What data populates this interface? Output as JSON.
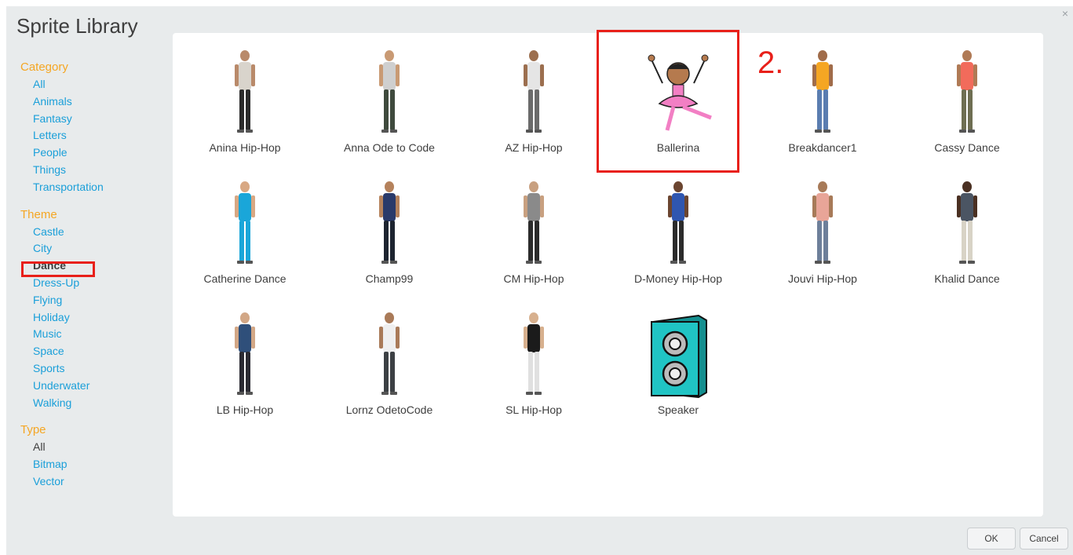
{
  "dialog": {
    "title": "Sprite Library",
    "close_glyph": "×"
  },
  "sidebar": {
    "category": {
      "heading": "Category",
      "items": [
        "All",
        "Animals",
        "Fantasy",
        "Letters",
        "People",
        "Things",
        "Transportation"
      ]
    },
    "theme": {
      "heading": "Theme",
      "items": [
        "Castle",
        "City",
        "Dance",
        "Dress-Up",
        "Flying",
        "Holiday",
        "Music",
        "Space",
        "Sports",
        "Underwater",
        "Walking"
      ],
      "selected": "Dance"
    },
    "type": {
      "heading": "Type",
      "items": [
        "All",
        "Bitmap",
        "Vector"
      ],
      "selected": "All"
    }
  },
  "sprites": [
    {
      "name": "Anina Hip-Hop",
      "kind": "person",
      "shirt": "#d9d4cc",
      "pants": "#2b2b2b",
      "skin": "#b98a6a"
    },
    {
      "name": "Anna Ode to Code",
      "kind": "person",
      "shirt": "#cfcfcf",
      "pants": "#3f4a3d",
      "skin": "#c99a74"
    },
    {
      "name": "AZ Hip-Hop",
      "kind": "person",
      "shirt": "#e5e5e5",
      "pants": "#6b6b6b",
      "skin": "#9c6f4f"
    },
    {
      "name": "Ballerina",
      "kind": "ballerina",
      "shirt": "#f27fc4",
      "pants": "#f27fc4",
      "skin": "#b57a4e"
    },
    {
      "name": "Breakdancer1",
      "kind": "person",
      "shirt": "#f5a623",
      "pants": "#5a7db0",
      "skin": "#a06c4a"
    },
    {
      "name": "Cassy Dance",
      "kind": "person",
      "shirt": "#f26b5b",
      "pants": "#6e6e52",
      "skin": "#b07a55"
    },
    {
      "name": "Catherine Dance",
      "kind": "person",
      "shirt": "#1aa6d9",
      "pants": "#1aa6d9",
      "skin": "#d8a883"
    },
    {
      "name": "Champ99",
      "kind": "person",
      "shirt": "#2a3a6a",
      "pants": "#1d2430",
      "skin": "#b5825c"
    },
    {
      "name": "CM Hip-Hop",
      "kind": "person",
      "shirt": "#8a8a8a",
      "pants": "#2b2b2b",
      "skin": "#c8a080"
    },
    {
      "name": "D-Money Hip-Hop",
      "kind": "person",
      "shirt": "#2f56b0",
      "pants": "#2b2b2b",
      "skin": "#6b4530"
    },
    {
      "name": "Jouvi Hip-Hop",
      "kind": "person",
      "shirt": "#e8a598",
      "pants": "#6d7f9a",
      "skin": "#a77a58"
    },
    {
      "name": "Khalid Dance",
      "kind": "person",
      "shirt": "#4b5563",
      "pants": "#d8d3c6",
      "skin": "#4a3022"
    },
    {
      "name": "LB Hip-Hop",
      "kind": "person",
      "shirt": "#2f4f7a",
      "pants": "#2b2b33",
      "skin": "#d2a786"
    },
    {
      "name": "Lornz OdetoCode",
      "kind": "person",
      "shirt": "#efefef",
      "pants": "#3c4044",
      "skin": "#a97a58"
    },
    {
      "name": "SL Hip-Hop",
      "kind": "person",
      "shirt": "#1b1b1b",
      "pants": "#e0e0e0",
      "skin": "#d7b08e"
    },
    {
      "name": "Speaker",
      "kind": "speaker",
      "shirt": "#20c4c4",
      "pants": "#20c4c4",
      "skin": "#20c4c4"
    }
  ],
  "annotation": {
    "step": "2."
  },
  "buttons": {
    "ok": "OK",
    "cancel": "Cancel"
  }
}
